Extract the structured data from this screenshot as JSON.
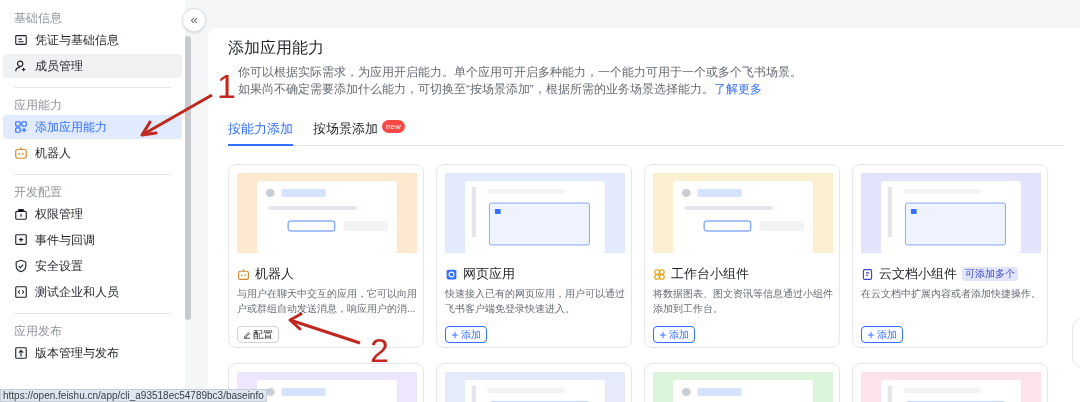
{
  "sidebar": {
    "sections": [
      {
        "title": "基础信息",
        "items": [
          {
            "label": "凭证与基础信息",
            "selected": false,
            "hovered": false
          },
          {
            "label": "成员管理",
            "selected": false,
            "hovered": true
          }
        ]
      },
      {
        "title": "应用能力",
        "items": [
          {
            "label": "添加应用能力",
            "selected": true,
            "hovered": false
          },
          {
            "label": "机器人",
            "selected": false,
            "hovered": false
          }
        ]
      },
      {
        "title": "开发配置",
        "items": [
          {
            "label": "权限管理",
            "selected": false,
            "hovered": false
          },
          {
            "label": "事件与回调",
            "selected": false,
            "hovered": false
          },
          {
            "label": "安全设置",
            "selected": false,
            "hovered": false
          },
          {
            "label": "测试企业和人员",
            "selected": false,
            "hovered": false
          }
        ]
      },
      {
        "title": "应用发布",
        "items": [
          {
            "label": "版本管理与发布",
            "selected": false,
            "hovered": false
          }
        ]
      }
    ]
  },
  "collapse_button": {
    "label": "«"
  },
  "main": {
    "title": "添加应用能力",
    "description": [
      "你可以根据实际需求，为应用开启能力。单个应用可开启多种能力，一个能力可用于一个或多个飞书场景。",
      "如果尚不确定需要添加什么能力，可切换至“按场景添加”，根据所需的业务场景选择能力。"
    ],
    "learn_more": "了解更多",
    "tabs": [
      {
        "label": "按能力添加",
        "selected": true
      },
      {
        "label": "按场景添加",
        "selected": false,
        "badge": "new"
      }
    ],
    "cards": [
      {
        "kind": "full",
        "title": "机器人",
        "description": "与用户在聊天中交互的应用，它可以向用户或群组自动发送消息，响应用户的消...",
        "button": {
          "kind": "configure",
          "label": "配置"
        }
      },
      {
        "kind": "full",
        "title": "网页应用",
        "description": "快速接入已有的网页应用，用户可以通过飞书客户端免登录快速进入。",
        "button": {
          "kind": "add",
          "label": "添加"
        }
      },
      {
        "kind": "full",
        "title": "工作台小组件",
        "description": "将数据图表、图文资讯等信息通过小组件添加到工作台。",
        "button": {
          "kind": "add",
          "label": "添加"
        }
      },
      {
        "kind": "full",
        "title": "云文档小组件",
        "badge": "可添加多个",
        "description": "在云文档中扩展内容或者添加快捷操作。",
        "button": {
          "kind": "add",
          "label": "添加"
        }
      },
      {
        "kind": "preview"
      },
      {
        "kind": "preview"
      },
      {
        "kind": "preview"
      },
      {
        "kind": "preview"
      }
    ]
  },
  "annotations": [
    {
      "label": "1"
    },
    {
      "label": "2"
    }
  ],
  "status_bar": {
    "url": "https://open.feishu.cn/app/cli_a93518ec54789bc3/baseinfo"
  }
}
